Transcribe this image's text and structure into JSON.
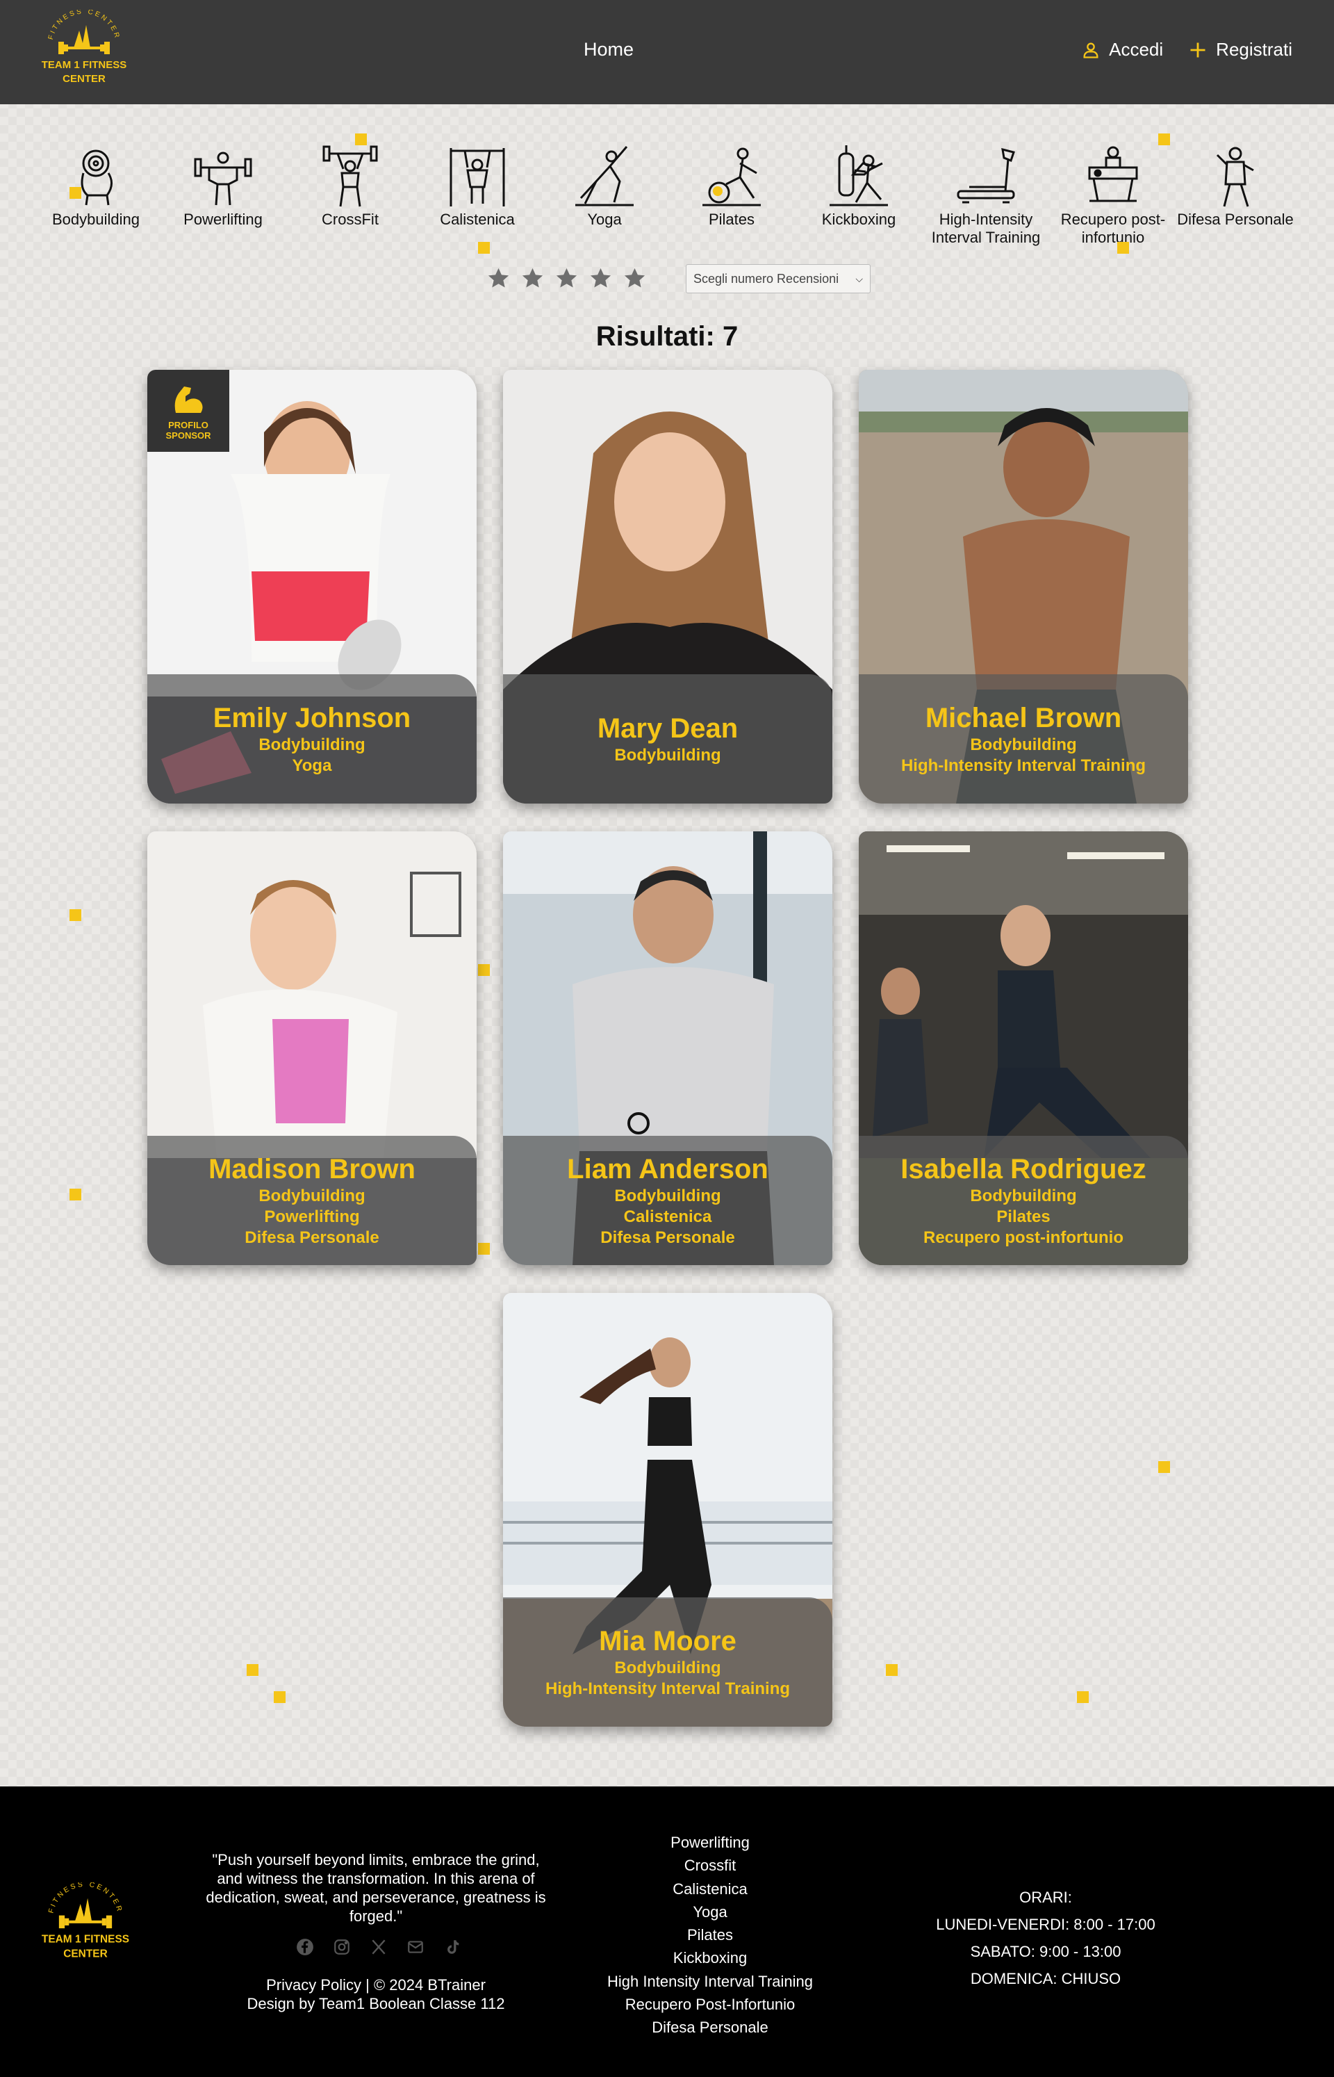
{
  "header": {
    "logo_text_top": "FITNESS CENTER",
    "logo_text_main": "TEAM 1 FITNESS",
    "logo_text_sub": "CENTER",
    "home_label": "Home",
    "login_label": "Accedi",
    "register_label": "Registrati"
  },
  "categories": [
    {
      "label": "Bodybuilding",
      "icon": "bodybuilding-icon"
    },
    {
      "label": "Powerlifting",
      "icon": "powerlifting-icon"
    },
    {
      "label": "CrossFit",
      "icon": "crossfit-icon"
    },
    {
      "label": "Calistenica",
      "icon": "calistenica-icon"
    },
    {
      "label": "Yoga",
      "icon": "yoga-icon"
    },
    {
      "label": "Pilates",
      "icon": "pilates-icon"
    },
    {
      "label": "Kickboxing",
      "icon": "kickboxing-icon"
    },
    {
      "label": "High-Intensity Interval Training",
      "icon": "treadmill-icon"
    },
    {
      "label": "Recupero post-infortunio",
      "icon": "recovery-icon"
    },
    {
      "label": "Difesa Personale",
      "icon": "self-defense-icon"
    }
  ],
  "filters": {
    "star_count": 5,
    "reviews_select": "Scegli numero Recensioni"
  },
  "results": {
    "title": "Risultati: 7"
  },
  "sponsor": {
    "line1": "PROFILO",
    "line2": "SPONSOR"
  },
  "trainers": [
    {
      "name": "Emily Johnson",
      "specs": [
        "Bodybuilding",
        "Yoga"
      ],
      "sponsor": true
    },
    {
      "name": "Mary Dean",
      "specs": [
        "Bodybuilding"
      ],
      "sponsor": false
    },
    {
      "name": "Michael Brown",
      "specs": [
        "Bodybuilding",
        "High-Intensity Interval Training"
      ],
      "sponsor": false
    },
    {
      "name": "Madison Brown",
      "specs": [
        "Bodybuilding",
        "Powerlifting",
        "Difesa Personale"
      ],
      "sponsor": false
    },
    {
      "name": "Liam Anderson",
      "specs": [
        "Bodybuilding",
        "Calistenica",
        "Difesa Personale"
      ],
      "sponsor": false
    },
    {
      "name": "Isabella Rodriguez",
      "specs": [
        "Bodybuilding",
        "Pilates",
        "Recupero post-infortunio"
      ],
      "sponsor": false
    },
    {
      "name": "Mia Moore",
      "specs": [
        "Bodybuilding",
        "High-Intensity Interval Training"
      ],
      "sponsor": false
    }
  ],
  "footer": {
    "quote": "\"Push yourself beyond limits, embrace the grind, and witness the transformation. In this arena of dedication, sweat, and perseverance, greatness is forged.\"",
    "privacy_label": "Privacy Policy",
    "copyright": " | © 2024 BTrainer",
    "design_credit": "Design by Team1 Boolean Classe 112",
    "links": [
      "Powerlifting",
      "Crossfit",
      "Calistenica",
      "Yoga",
      "Pilates",
      "Kickboxing",
      "High Intensity Interval Training",
      "Recupero Post-Infortunio",
      "Difesa Personale"
    ],
    "hours_title": "ORARI:",
    "hours_weekdays": "LUNEDI-VENERDI: 8:00 - 17:00",
    "hours_saturday": "SABATO: 9:00 - 13:00",
    "hours_sunday": "DOMENICA: CHIUSO"
  },
  "colors": {
    "accent": "#f5c518",
    "header_bg": "#3a3a3a",
    "footer_bg": "#000000"
  }
}
